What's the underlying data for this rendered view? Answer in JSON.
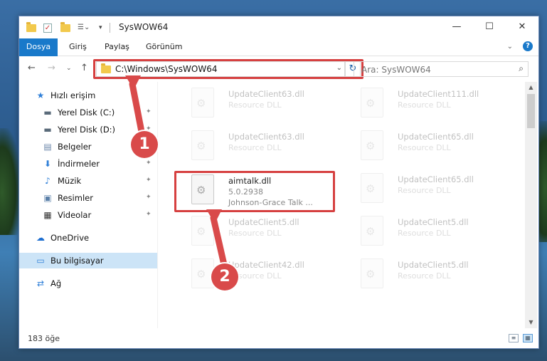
{
  "window": {
    "title": "SysWOW64",
    "controls": {
      "minimize": "—",
      "maximize": "☐",
      "close": "✕"
    }
  },
  "ribbon": {
    "tabs": [
      "Dosya",
      "Giriş",
      "Paylaş",
      "Görünüm"
    ],
    "help": "?",
    "collapse": "⌄"
  },
  "nav": {
    "back": "←",
    "forward": "→",
    "recent": "⌄",
    "up": "↑",
    "address": "C:\\Windows\\SysWOW64",
    "address_dropdown": "⌄",
    "refresh": "↻",
    "search_placeholder": "Ara: SysWOW64"
  },
  "sidebar": {
    "items": [
      {
        "label": "Hızlı erişim",
        "icon": "star-icon",
        "glyph": "★",
        "color": "#2f7fd8"
      },
      {
        "label": "Yerel Disk (C:)",
        "icon": "drive-icon",
        "glyph": "▬",
        "color": "#5a6b7a",
        "pinned": true
      },
      {
        "label": "Yerel Disk (D:)",
        "icon": "drive-icon",
        "glyph": "▬",
        "color": "#5a6b7a",
        "pinned": true
      },
      {
        "label": "Belgeler",
        "icon": "document-icon",
        "glyph": "▤",
        "color": "#6a85a8",
        "pinned": true
      },
      {
        "label": "İndirmeler",
        "icon": "download-icon",
        "glyph": "⬇",
        "color": "#2f7fd8",
        "pinned": true
      },
      {
        "label": "Müzik",
        "icon": "music-icon",
        "glyph": "♪",
        "color": "#2f7fd8",
        "pinned": true
      },
      {
        "label": "Resimler",
        "icon": "pictures-icon",
        "glyph": "▣",
        "color": "#5a7fa8",
        "pinned": true
      },
      {
        "label": "Videolar",
        "icon": "video-icon",
        "glyph": "▦",
        "color": "#333",
        "pinned": true
      },
      {
        "label": "OneDrive",
        "icon": "cloud-icon",
        "glyph": "☁",
        "color": "#1f6fd0"
      },
      {
        "label": "Bu bilgisayar",
        "icon": "computer-icon",
        "glyph": "▭",
        "color": "#2f7fd8",
        "selected": true
      },
      {
        "label": "Ağ",
        "icon": "network-icon",
        "glyph": "⇄",
        "color": "#2f7fd8"
      }
    ],
    "pin_glyph": "📌"
  },
  "files": [
    {
      "name": "UpdateClient63.dll",
      "desc": "Resource DLL",
      "faded": true
    },
    {
      "name": "UpdateClient111.dll",
      "desc": "Resource DLL",
      "faded": true
    },
    {
      "name": "UpdateClient63.dll",
      "desc": "Resource DLL",
      "faded": true
    },
    {
      "name": "UpdateClient65.dll",
      "desc": "Resource DLL",
      "faded": true
    },
    {
      "name": "aimtalk.dll",
      "desc": "5.0.2938",
      "desc2": "Johnson-Grace Talk ...",
      "faded": false
    },
    {
      "name": "UpdateClient65.dll",
      "desc": "Resource DLL",
      "faded": true
    },
    {
      "name": "UpdateClient5.dll",
      "desc": "Resource DLL",
      "faded": true
    },
    {
      "name": "UpdateClient5.dll",
      "desc": "Resource DLL",
      "faded": true
    },
    {
      "name": "UpdateClient42.dll",
      "desc": "Resource DLL",
      "faded": true
    },
    {
      "name": "UpdateClient5.dll",
      "desc": "Resource DLL",
      "faded": true
    }
  ],
  "status": {
    "count": "183 öğe"
  },
  "callouts": [
    "1",
    "2"
  ],
  "colors": {
    "accent": "#1979ca",
    "highlight": "#d64040",
    "selection": "#cce4f7"
  }
}
